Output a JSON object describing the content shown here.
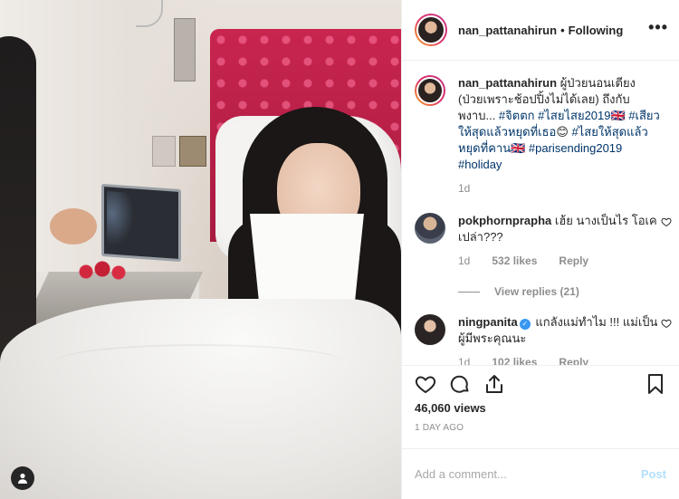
{
  "post": {
    "username": "nan_pattanahirun",
    "follow_status": "Following",
    "more_label": "•••",
    "separator": "•"
  },
  "caption": {
    "username": "nan_pattanahirun",
    "text": " ผู้ป่วยนอนเตียง (ป่วยเพราะช้อปปิ้งไม่ได้เลย) ถึงกับพงาบ... ",
    "tag1": "#จิตตก",
    "tag2": "#ไสยไสย2019",
    "flag1": "🇬🇧",
    "tag3": "#เสียวให้สุดแล้วหยุดที่เธอ",
    "emoji": "😊",
    "tag4": "#ไสยให้สุดแล้วหยุดที่คาน",
    "flag2": "🇬🇧",
    "tag5": "#parisending2019",
    "tag6": "#holiday",
    "age": "1d"
  },
  "comments": [
    {
      "username": "pokphornprapha",
      "text": " เฮ้ย นางเป็นไร โอเคเปล่า???",
      "age": "1d",
      "likes": "532 likes",
      "reply": "Reply",
      "view_replies": "View replies (21)"
    },
    {
      "username": "ningpanita",
      "verified_mark": "✓",
      "text": " แกลังแม่ทำไม !!! แม่เป็นผู้มีพระคุณนะ",
      "age": "1d",
      "likes": "102 likes",
      "reply": "Reply"
    }
  ],
  "stats": {
    "views": "46,060 views",
    "time_ago": "1 DAY AGO"
  },
  "composer": {
    "placeholder": "Add a comment...",
    "post_label": "Post"
  },
  "colors": {
    "link": "#003569",
    "muted": "#8e8e8e",
    "post_disabled": "#b2dffc",
    "verified": "#3897f0"
  }
}
